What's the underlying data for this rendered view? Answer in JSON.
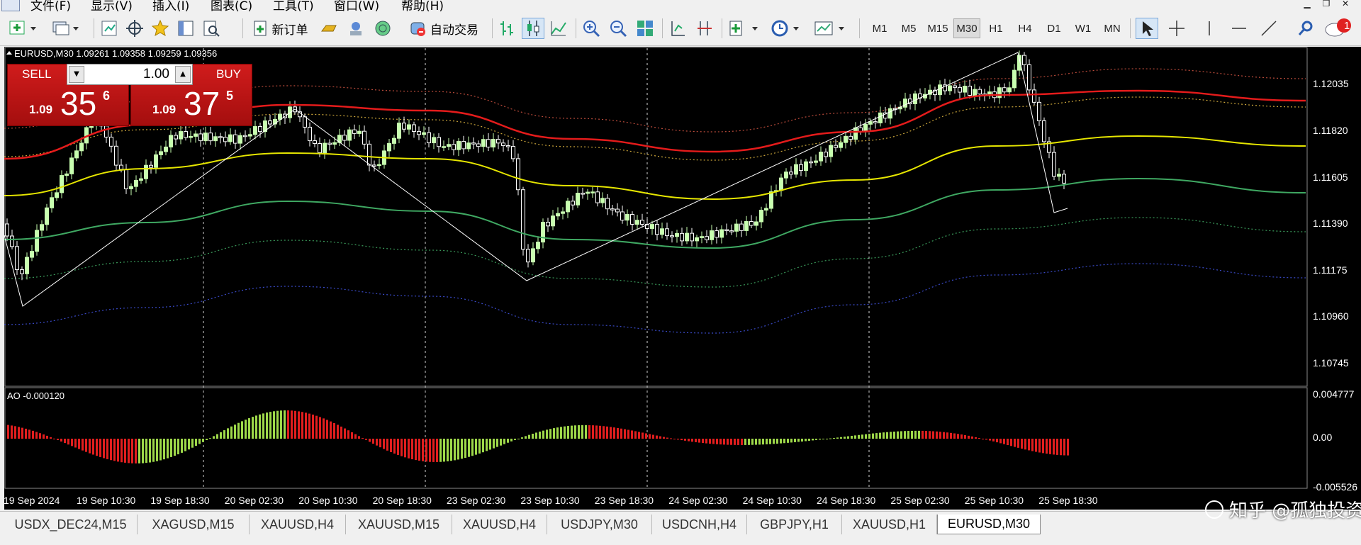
{
  "menubar": {
    "items": [
      "文件(F)",
      "显示(V)",
      "插入(I)",
      "图表(C)",
      "工具(T)",
      "窗口(W)",
      "帮助(H)"
    ]
  },
  "toolbar": {
    "new_order_label": "新订单",
    "auto_trading_label": "自动交易",
    "timeframes": [
      "M1",
      "M5",
      "M15",
      "M30",
      "H1",
      "H4",
      "D1",
      "W1",
      "MN"
    ],
    "active_timeframe": "M30",
    "notification_count": "1"
  },
  "chart": {
    "header": "EURUSD,M30  1.09261 1.09358 1.09259 1.09356",
    "price_labels": [
      "1.12035",
      "1.11820",
      "1.11605",
      "1.11390",
      "1.11175",
      "1.10960",
      "1.10745"
    ],
    "ao_label": "AO -0.000120",
    "ao_axis_labels": [
      "0.004777",
      "0.00",
      "-0.005526"
    ],
    "time_labels": [
      "19 Sep 2024",
      "19 Sep 10:30",
      "19 Sep 18:30",
      "20 Sep 02:30",
      "20 Sep 10:30",
      "20 Sep 18:30",
      "23 Sep 02:30",
      "23 Sep 10:30",
      "23 Sep 18:30",
      "24 Sep 02:30",
      "24 Sep 10:30",
      "24 Sep 18:30",
      "25 Sep 02:30",
      "25 Sep 10:30",
      "25 Sep 18:30"
    ],
    "colors": {
      "background": "#000000",
      "bull_candle": "#c8ffb0",
      "ma_red": "#e41b1b",
      "ma_yellow": "#e6e600",
      "ma_green": "#3fa862",
      "ao_up": "#9ed84a",
      "ao_down": "#e21e1e"
    }
  },
  "trade_panel": {
    "sell_label": "SELL",
    "buy_label": "BUY",
    "lot": "1.00",
    "sell_prefix": "1.09",
    "sell_big": "35",
    "sell_sup": "6",
    "buy_prefix": "1.09",
    "buy_big": "37",
    "buy_sup": "5"
  },
  "tabs": [
    "USDX_DEC24,M15",
    "XAGUSD,M15",
    "XAUUSD,H4",
    "XAUUSD,M15",
    "XAUUSD,H4",
    "USDJPY,M30",
    "USDCNH,H4",
    "GBPJPY,H1",
    "XAUUSD,H1",
    "EURUSD,M30"
  ],
  "active_tab": "EURUSD,M30",
  "watermark": "知乎 @孤独投资人"
}
